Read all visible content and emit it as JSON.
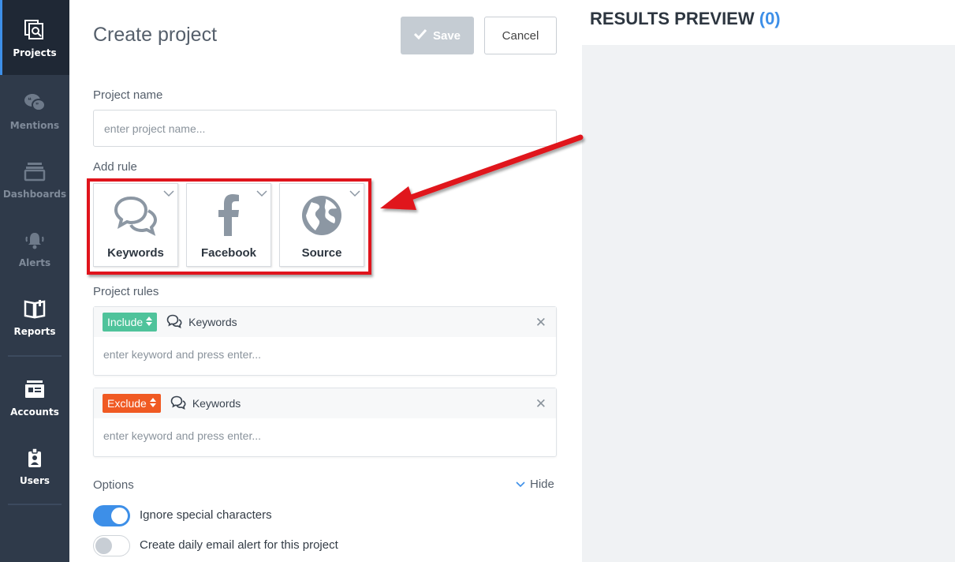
{
  "sidebar": {
    "items": [
      {
        "label": "Projects",
        "icon": "projects-icon"
      },
      {
        "label": "Mentions",
        "icon": "mentions-icon"
      },
      {
        "label": "Dashboards",
        "icon": "dashboards-icon"
      },
      {
        "label": "Alerts",
        "icon": "alerts-icon"
      },
      {
        "label": "Reports",
        "icon": "reports-icon"
      },
      {
        "label": "Accounts",
        "icon": "accounts-icon"
      },
      {
        "label": "Users",
        "icon": "users-icon"
      }
    ]
  },
  "form": {
    "title": "Create project",
    "save_label": "Save",
    "cancel_label": "Cancel",
    "project_name_label": "Project name",
    "project_name_placeholder": "enter project name...",
    "add_rule_label": "Add rule",
    "rule_types": [
      {
        "label": "Keywords",
        "icon": "speech-bubbles-icon"
      },
      {
        "label": "Facebook",
        "icon": "facebook-icon"
      },
      {
        "label": "Source",
        "icon": "globe-icon"
      }
    ],
    "project_rules_label": "Project rules",
    "rules": [
      {
        "mode": "Include",
        "type": "Keywords",
        "placeholder": "enter keyword and press enter..."
      },
      {
        "mode": "Exclude",
        "type": "Keywords",
        "placeholder": "enter keyword and press enter..."
      }
    ],
    "options_label": "Options",
    "hide_label": "Hide",
    "options": [
      {
        "label": "Ignore special characters",
        "enabled": true
      },
      {
        "label": "Create daily email alert for this project",
        "enabled": false
      }
    ]
  },
  "preview": {
    "title": "RESULTS PREVIEW",
    "count": "(0)"
  },
  "colors": {
    "sidebar_bg": "#2f3a4a",
    "accent": "#3d8fe8",
    "include": "#4fc39b",
    "exclude": "#f05a23",
    "highlight": "#e0141c"
  }
}
